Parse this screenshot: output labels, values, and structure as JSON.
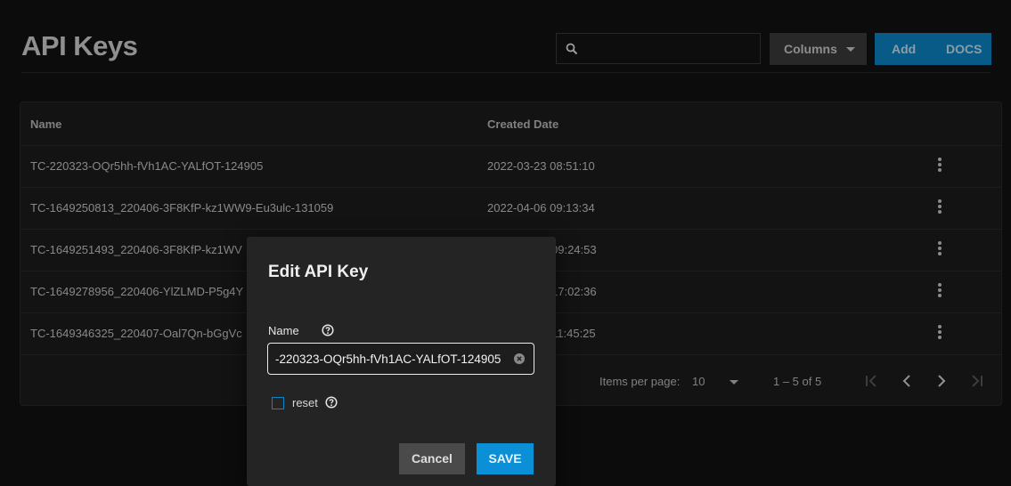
{
  "page": {
    "title": "API Keys"
  },
  "toolbar": {
    "search_value": "",
    "columns_label": "Columns",
    "add_label": "Add",
    "docs_label": "DOCS"
  },
  "table": {
    "headers": {
      "name": "Name",
      "created_date": "Created Date"
    },
    "rows": [
      {
        "name": "TC-220323-OQr5hh-fVh1AC-YALfOT-124905",
        "created_date": "2022-03-23 08:51:10"
      },
      {
        "name": "TC-1649250813_220406-3F8KfP-kz1WW9-Eu3ulc-131059",
        "created_date": "2022-04-06 09:13:34"
      },
      {
        "name": "TC-1649251493_220406-3F8KfP-kz1WV",
        "created_date": "09:24:53"
      },
      {
        "name": "TC-1649278956_220406-YlZLMD-P5g4Y",
        "created_date": "17:02:36"
      },
      {
        "name": "TC-1649346325_220407-Oal7Qn-bGgVc",
        "created_date": "11:45:25"
      }
    ],
    "paginator": {
      "items_per_page_label": "Items per page:",
      "items_per_page_value": "10",
      "range_label": "1 – 5 of 5"
    }
  },
  "dialog": {
    "title": "Edit API Key",
    "name_label": "Name",
    "name_value": "-220323-OQr5hh-fVh1AC-YALfOT-124905",
    "reset_label": "reset",
    "reset_checked": false,
    "cancel_label": "Cancel",
    "save_label": "SAVE"
  },
  "colors": {
    "accent": "#0b86c6",
    "background": "#121212",
    "card": "#1d1d1d",
    "dialog": "#242424"
  },
  "icons": [
    "search-icon",
    "caret-down-icon",
    "more-vert-icon",
    "first-page-icon",
    "prev-page-icon",
    "next-page-icon",
    "last-page-icon",
    "help-icon",
    "clear-icon"
  ]
}
